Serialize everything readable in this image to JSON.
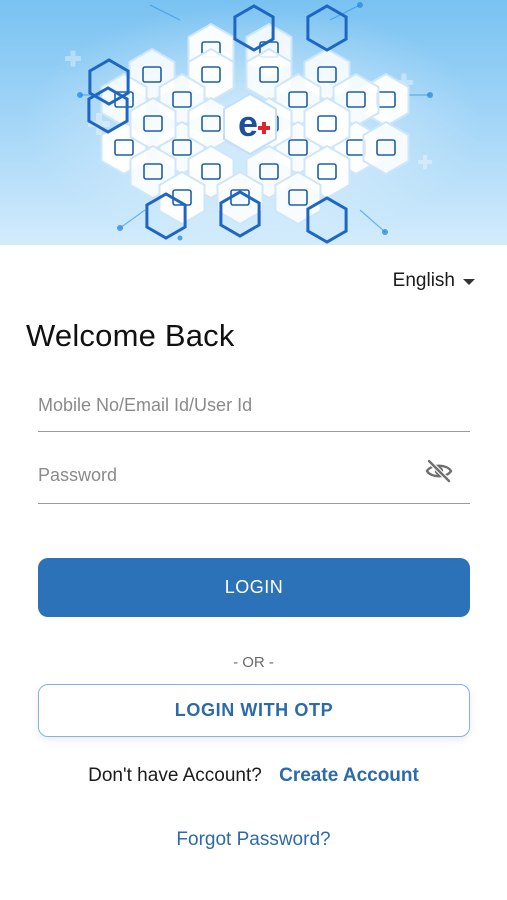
{
  "header": {
    "banner_icon": "healthcare-hexagon-collage",
    "center_logo_text": "e",
    "colors": {
      "sky_top": "#79c2f2",
      "sky_bottom": "#d3ecfc",
      "hex_outline": "#1f66c4",
      "icon_blue": "#1f5fa8"
    }
  },
  "language": {
    "selected": "English",
    "icon": "caret-down-icon"
  },
  "title": "Welcome Back",
  "form": {
    "user_placeholder": "Mobile No/Email Id/User Id",
    "user_value": "",
    "password_placeholder": "Password",
    "password_value": "",
    "password_toggle_icon": "eye-off-icon"
  },
  "buttons": {
    "login": "LOGIN",
    "or_separator": "- OR -",
    "login_otp": "LOGIN WITH OTP"
  },
  "signup": {
    "question": "Don't have Account?",
    "link": "Create Account"
  },
  "forgot_password": "Forgot Password?",
  "theme": {
    "primary": "#2b72b8",
    "link": "#2b6aab"
  }
}
